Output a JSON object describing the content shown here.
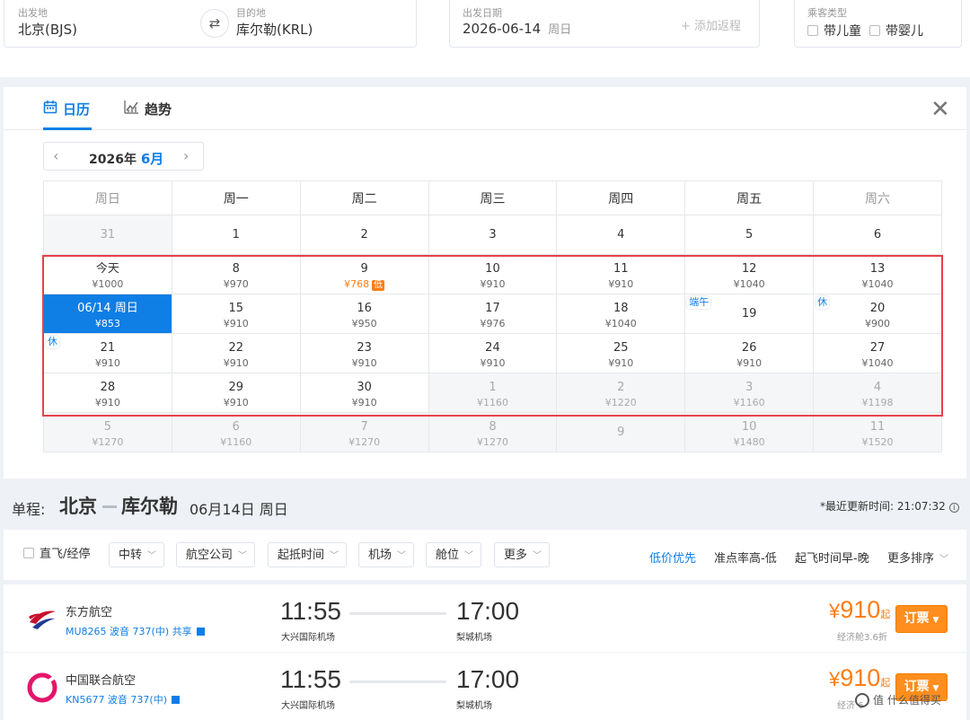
{
  "search": {
    "from": {
      "label": "出发地",
      "value": "北京(BJS)"
    },
    "swap_icon": "swap-arrows-icon",
    "to": {
      "label": "目的地",
      "value": "库尔勒(KRL)"
    },
    "depart": {
      "label": "出发日期",
      "value": "2026-06-14",
      "weekday": "周日",
      "add_return": "+ 添加返程"
    },
    "passenger": {
      "label": "乘客类型",
      "child": "带儿童",
      "infant": "带婴儿"
    }
  },
  "calendar": {
    "tab_calendar": "日历",
    "tab_trend": "趋势",
    "year": "2026年",
    "month": "6月",
    "weekdays": [
      "周日",
      "周一",
      "周二",
      "周三",
      "周四",
      "周五",
      "周六"
    ],
    "lowest_tag": "低",
    "weeks": [
      [
        {
          "day": "31",
          "price": "",
          "grey": true
        },
        {
          "day": "1",
          "price": ""
        },
        {
          "day": "2",
          "price": ""
        },
        {
          "day": "3",
          "price": ""
        },
        {
          "day": "4",
          "price": ""
        },
        {
          "day": "5",
          "price": ""
        },
        {
          "day": "6",
          "price": ""
        }
      ],
      [
        {
          "day": "今天",
          "price": "¥1000"
        },
        {
          "day": "8",
          "price": "¥970"
        },
        {
          "day": "9",
          "price": "¥768",
          "lowest": true
        },
        {
          "day": "10",
          "price": "¥910"
        },
        {
          "day": "11",
          "price": "¥910"
        },
        {
          "day": "12",
          "price": "¥1040"
        },
        {
          "day": "13",
          "price": "¥1040"
        }
      ],
      [
        {
          "day": "06/14 周日",
          "price": "¥853",
          "selected": true
        },
        {
          "day": "15",
          "price": "¥910"
        },
        {
          "day": "16",
          "price": "¥950"
        },
        {
          "day": "17",
          "price": "¥976"
        },
        {
          "day": "18",
          "price": "¥1040"
        },
        {
          "day": "19",
          "price": "",
          "tag": "端午"
        },
        {
          "day": "20",
          "price": "¥900",
          "tag": "休"
        }
      ],
      [
        {
          "day": "21",
          "price": "¥910",
          "tag": "休"
        },
        {
          "day": "22",
          "price": "¥910"
        },
        {
          "day": "23",
          "price": "¥910"
        },
        {
          "day": "24",
          "price": "¥910"
        },
        {
          "day": "25",
          "price": "¥910"
        },
        {
          "day": "26",
          "price": "¥910"
        },
        {
          "day": "27",
          "price": "¥1040"
        }
      ],
      [
        {
          "day": "28",
          "price": "¥910"
        },
        {
          "day": "29",
          "price": "¥910"
        },
        {
          "day": "30",
          "price": "¥910"
        },
        {
          "day": "1",
          "price": "¥1160",
          "grey": true
        },
        {
          "day": "2",
          "price": "¥1220",
          "grey": true
        },
        {
          "day": "3",
          "price": "¥1160",
          "grey": true
        },
        {
          "day": "4",
          "price": "¥1198",
          "grey": true
        }
      ],
      [
        {
          "day": "5",
          "price": "¥1270",
          "grey": true
        },
        {
          "day": "6",
          "price": "¥1160",
          "grey": true
        },
        {
          "day": "7",
          "price": "¥1270",
          "grey": true
        },
        {
          "day": "8",
          "price": "¥1270",
          "grey": true
        },
        {
          "day": "9",
          "price": "",
          "grey": true
        },
        {
          "day": "10",
          "price": "¥1480",
          "grey": true
        },
        {
          "day": "11",
          "price": "¥1520",
          "grey": true
        }
      ]
    ]
  },
  "route": {
    "prefix": "单程:",
    "from_city": "北京",
    "to_city": "库尔勒",
    "date": "06月14日 周日",
    "updated_label": "*最近更新时间:",
    "updated_time": "21:07:32"
  },
  "filters": {
    "direct": "直飞/经停",
    "dropdowns": [
      "中转",
      "航空公司",
      "起抵时间",
      "机场",
      "舱位",
      "更多"
    ],
    "sorts": [
      "低价优先",
      "准点率高-低",
      "起飞时间早-晚",
      "更多排序"
    ]
  },
  "flights": [
    {
      "airline": "东方航空",
      "flight_info": "MU8265 波音 737(中)  共享",
      "logo_icon": "china-eastern-logo-icon",
      "depart_time": "11:55",
      "depart_airport": "大兴国际机场",
      "arrive_time": "17:00",
      "arrive_airport": "梨城机场",
      "price_symbol": "¥",
      "price": "910",
      "price_suffix": "起",
      "cabin": "经济舱3.6折",
      "book": "订票"
    },
    {
      "airline": "中国联合航空",
      "flight_info": "KN5677 波音 737(中)",
      "logo_icon": "china-united-logo-icon",
      "depart_time": "11:55",
      "depart_airport": "大兴国际机场",
      "arrive_time": "17:00",
      "arrive_airport": "梨城机场",
      "price_symbol": "¥",
      "price": "910",
      "price_suffix": "起",
      "cabin": "经济",
      "cabin_tail": "6",
      "book": "订票"
    }
  ],
  "watermark": "值 什么值得买",
  "colors": {
    "accent": "#0f7ee5",
    "price": "#ff7d13",
    "highlight_box": "#e8414b",
    "book_button": "#ff8e1f"
  }
}
